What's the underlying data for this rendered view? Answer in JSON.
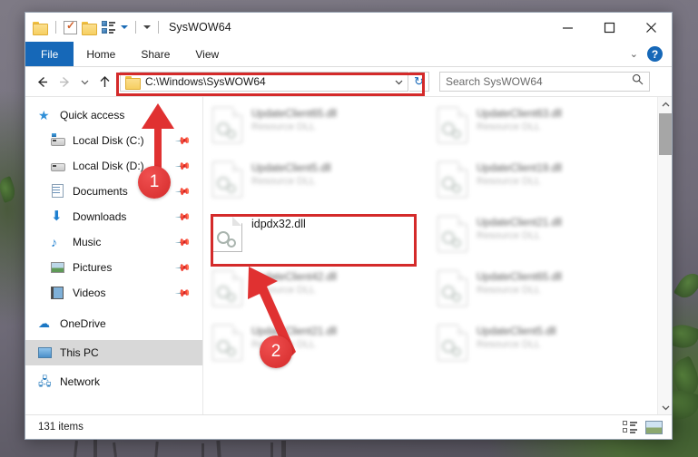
{
  "window": {
    "title": "SysWOW64",
    "quick_access_icons": [
      "folder-icon",
      "properties-check-icon",
      "folder-icon",
      "properties-list-icon",
      "customize-dropdown-icon"
    ],
    "controls": {
      "minimize": "minimize-icon",
      "maximize": "maximize-icon",
      "close": "close-icon"
    }
  },
  "ribbon": {
    "tabs": [
      {
        "label": "File",
        "active": true
      },
      {
        "label": "Home",
        "active": false
      },
      {
        "label": "Share",
        "active": false
      },
      {
        "label": "View",
        "active": false
      }
    ],
    "collapse_icon": "chevron-down-icon",
    "help_label": "?"
  },
  "navigation": {
    "back": "back-arrow-icon",
    "forward": "forward-arrow-icon",
    "recent": "chevron-down-icon",
    "up": "up-arrow-icon",
    "address_value": "C:\\Windows\\SysWOW64",
    "address_dropdown": "chevron-down-icon",
    "refresh": "refresh-icon"
  },
  "search": {
    "placeholder": "Search SysWOW64",
    "icon": "search-icon"
  },
  "sidebar": {
    "items": [
      {
        "label": "Quick access",
        "icon": "star-icon",
        "indent": false,
        "pinned": false,
        "selected": false
      },
      {
        "label": "Local Disk (C:)",
        "icon": "disk-system-icon",
        "indent": true,
        "pinned": true,
        "selected": false
      },
      {
        "label": "Local Disk (D:)",
        "icon": "disk-icon",
        "indent": true,
        "pinned": true,
        "selected": false
      },
      {
        "label": "Documents",
        "icon": "document-icon",
        "indent": true,
        "pinned": true,
        "selected": false
      },
      {
        "label": "Downloads",
        "icon": "download-icon",
        "indent": true,
        "pinned": true,
        "selected": false
      },
      {
        "label": "Music",
        "icon": "music-icon",
        "indent": true,
        "pinned": true,
        "selected": false
      },
      {
        "label": "Pictures",
        "icon": "pictures-icon",
        "indent": true,
        "pinned": true,
        "selected": false
      },
      {
        "label": "Videos",
        "icon": "videos-icon",
        "indent": true,
        "pinned": true,
        "selected": false
      },
      {
        "label": "OneDrive",
        "icon": "cloud-icon",
        "indent": false,
        "pinned": false,
        "selected": false
      },
      {
        "label": "This PC",
        "icon": "computer-icon",
        "indent": false,
        "pinned": false,
        "selected": true
      },
      {
        "label": "Network",
        "icon": "network-icon",
        "indent": false,
        "pinned": false,
        "selected": false
      }
    ]
  },
  "files": {
    "subtitle_default": "Resource DLL",
    "items": [
      {
        "name": "UpdateClient65.dll",
        "sub": "Resource DLL",
        "blurred": true,
        "highlighted": false
      },
      {
        "name": "UpdateClient63.dll",
        "sub": "Resource DLL",
        "blurred": true,
        "highlighted": false
      },
      {
        "name": "UpdateClient5.dll",
        "sub": "Resource DLL",
        "blurred": true,
        "highlighted": false
      },
      {
        "name": "UpdateClient19.dll",
        "sub": "Resource DLL",
        "blurred": true,
        "highlighted": false
      },
      {
        "name": "idpdx32.dll",
        "sub": "",
        "blurred": false,
        "highlighted": true
      },
      {
        "name": "UpdateClient21.dll",
        "sub": "Resource DLL",
        "blurred": true,
        "highlighted": false
      },
      {
        "name": "UpdateClient42.dll",
        "sub": "Resource DLL",
        "blurred": true,
        "highlighted": false
      },
      {
        "name": "UpdateClient65.dll",
        "sub": "Resource DLL",
        "blurred": true,
        "highlighted": false
      },
      {
        "name": "UpdateClient21.dll",
        "sub": "Resource DLL",
        "blurred": true,
        "highlighted": false
      },
      {
        "name": "UpdateClient5.dll",
        "sub": "Resource DLL",
        "blurred": true,
        "highlighted": false
      }
    ]
  },
  "scrollbar": {
    "up": "chevron-up-icon",
    "down": "chevron-down-icon"
  },
  "statusbar": {
    "count": "131 items",
    "details_view": "details-view-icon",
    "large_icons_view": "large-icons-view-icon"
  },
  "annotations": {
    "badges": [
      {
        "number": "1",
        "target": "address-bar"
      },
      {
        "number": "2",
        "target": "idpdx32-file"
      }
    ],
    "accent_color": "#d42a2a"
  }
}
